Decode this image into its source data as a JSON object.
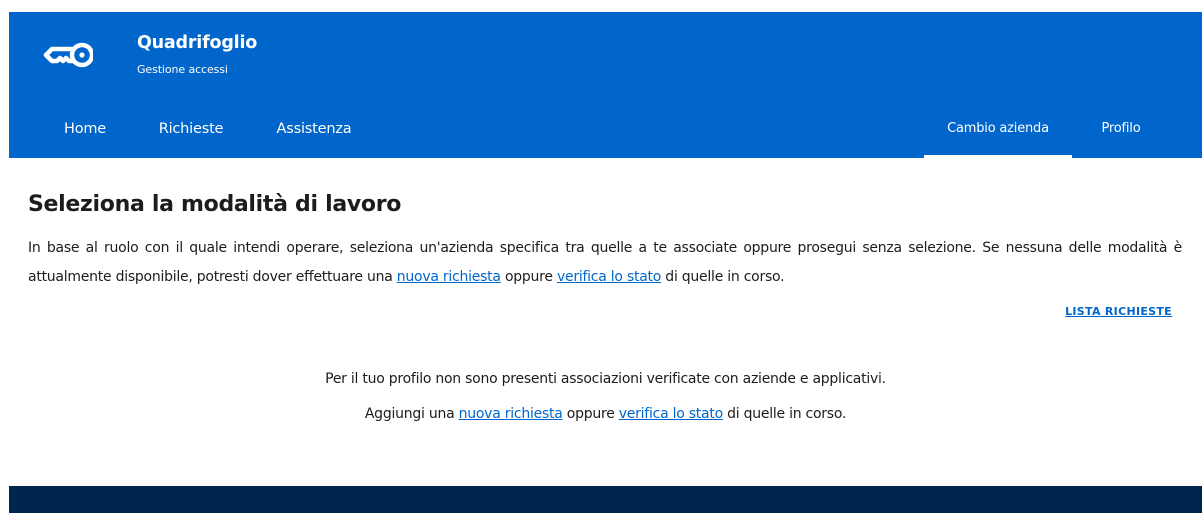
{
  "brand": {
    "title": "Quadrifoglio",
    "subtitle": "Gestione accessi",
    "logo_icon": "key-icon"
  },
  "nav": {
    "left": [
      {
        "label": "Home"
      },
      {
        "label": "Richieste"
      },
      {
        "label": "Assistenza"
      }
    ],
    "right": [
      {
        "label": "Cambio azienda",
        "active": true
      },
      {
        "label": "Profilo",
        "active": false
      }
    ]
  },
  "main": {
    "title": "Seleziona la modalità di lavoro",
    "intro": {
      "text_before": "In base al ruolo con il quale intendi operare, seleziona un'azienda specifica tra quelle a te associate oppure prosegui senza selezione. Se nessuna delle modalità è attualmente disponibile, potresti dover effettuare una ",
      "link1": "nuova richiesta",
      "text_mid": " oppure ",
      "link2": "verifica lo stato",
      "text_after": " di quelle in corso."
    },
    "list_link": "LISTA RICHIESTE",
    "empty_state": {
      "line1": "Per il tuo profilo non sono presenti associazioni verificate con aziende e applicativi.",
      "line2_before": "Aggiungi una ",
      "link1": "nuova richiesta",
      "line2_mid": " oppure ",
      "link2": "verifica lo stato",
      "line2_after": " di quelle in corso."
    }
  },
  "colors": {
    "primary": "#0066cc",
    "footer": "#00264d",
    "text": "#1c1c1c"
  }
}
